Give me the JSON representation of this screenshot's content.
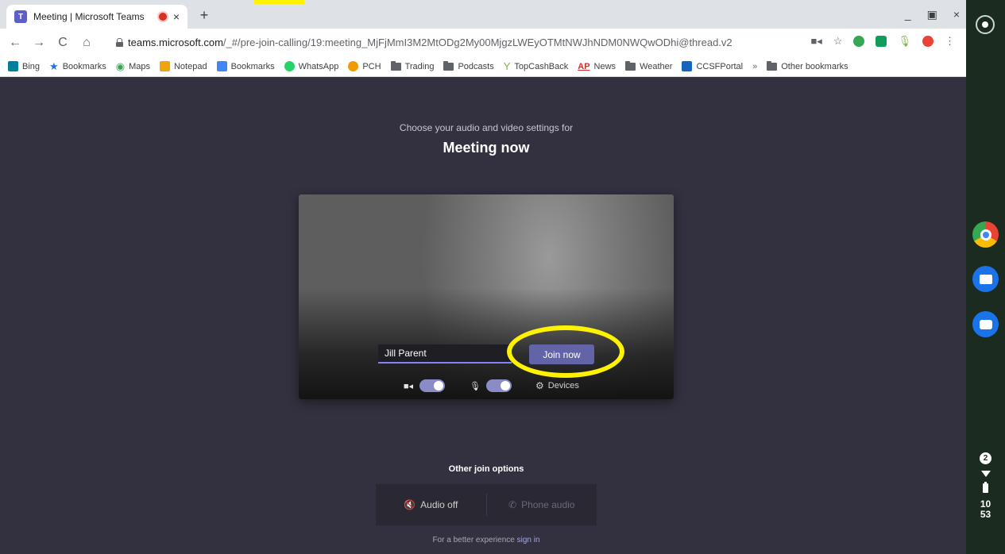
{
  "browser": {
    "tab_title": "Meeting | Microsoft Teams",
    "tab_close": "×",
    "new_tab": "+",
    "window_controls": {
      "minimize": "_",
      "restore": "▣",
      "close": "×"
    },
    "nav": {
      "back": "←",
      "forward": "→",
      "reload": "C",
      "home": "⌂"
    },
    "url_host": "teams.microsoft.com",
    "url_path": "/_#/pre-join-calling/19:meeting_MjFjMmI3M2MtODg2My00MjgzLWEyOTMtNWJhNDM0NWQwODhi@thread.v2",
    "bookmarks": [
      {
        "label": "Bing",
        "icon": "bing-icon",
        "color": "#00809d"
      },
      {
        "label": "Bookmarks",
        "icon": "star-icon",
        "color": "#1a73e8"
      },
      {
        "label": "Maps",
        "icon": "maps-pin-icon",
        "color": "#34a853"
      },
      {
        "label": "Notepad",
        "icon": "notepad-icon",
        "color": "#f0a30a"
      },
      {
        "label": "Bookmarks",
        "icon": "bookmarks-doc-icon",
        "color": "#4285f4"
      },
      {
        "label": "WhatsApp",
        "icon": "whatsapp-icon",
        "color": "#25d366"
      },
      {
        "label": "PCH",
        "icon": "pch-icon",
        "color": "#f29900"
      },
      {
        "label": "Trading",
        "icon": "folder-icon",
        "color": "#5f6368"
      },
      {
        "label": "Podcasts",
        "icon": "folder-icon",
        "color": "#5f6368"
      },
      {
        "label": "TopCashBack",
        "icon": "topcashback-icon",
        "color": "#7cb342"
      },
      {
        "label": "News",
        "icon": "ap-news-icon",
        "color": "#d32f2f"
      },
      {
        "label": "Weather",
        "icon": "folder-icon",
        "color": "#5f6368"
      },
      {
        "label": "CCSFPortal",
        "icon": "sf-icon",
        "color": "#1565c0"
      }
    ],
    "overflow_label": "»",
    "other_bookmarks": "Other bookmarks"
  },
  "prejoin": {
    "subtitle": "Choose your audio and video settings for",
    "title": "Meeting now",
    "name_value": "Jill Parent",
    "join_label": "Join now",
    "devices_label": "Devices",
    "camera_on": true,
    "mic_on": true,
    "other_options_label": "Other join options",
    "audio_off_label": "Audio off",
    "phone_audio_label": "Phone audio",
    "footer_text": "For a better experience",
    "footer_link": "sign in"
  },
  "shelf": {
    "notification_count": "2",
    "clock_hour": "10",
    "clock_minute": "53"
  },
  "colors": {
    "teams_bg": "#33313f",
    "teams_accent": "#6264a7",
    "highlight": "#fff200",
    "shelf_bg": "#1c2b1f"
  }
}
